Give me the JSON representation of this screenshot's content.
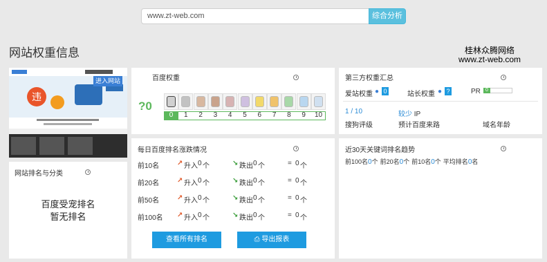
{
  "search": {
    "value": "www.zt-web.com",
    "button": "综合分析"
  },
  "page_title": "网站权重信息",
  "brand": {
    "line1": "桂林众腾网络",
    "line2": "www.zt-web.com"
  },
  "screenshot": {
    "enter_button": "进入网站"
  },
  "rank_panel": {
    "title": "网站排名与分类",
    "line1": "百度受宠排名",
    "line2": "暂无排名"
  },
  "baidu": {
    "title": "百度权重",
    "value": "?0",
    "scale": [
      "0",
      "1",
      "2",
      "3",
      "4",
      "5",
      "6",
      "7",
      "8",
      "9",
      "10"
    ],
    "colors": {
      "gray": "#8a8a8a",
      "accent": "#5cb85c"
    }
  },
  "third": {
    "title": "第三方权重汇总",
    "aizhan_label": "爱站权重",
    "aizhan_value": "0",
    "zhanzhang_label": "站长权重",
    "zhanzhang_value": "?",
    "pr_label": "PR",
    "pr_value": "0",
    "sogou_value": "1 / 10",
    "sogou_label": "搜狗评级",
    "traffic_value": "较少",
    "traffic_unit": "IP",
    "traffic_label": "预计百度来路",
    "age_label": "域名年龄"
  },
  "trend": {
    "title": "每日百度排名涨跌情况",
    "rows": [
      {
        "label": "前10名",
        "in_label": "升入",
        "in_val": "0",
        "in_unit": "个",
        "out_label": "跌出",
        "out_val": "0",
        "out_unit": "个",
        "eq": "=",
        "net": "0",
        "net_unit": "个"
      },
      {
        "label": "前20名",
        "in_label": "升入",
        "in_val": "0",
        "in_unit": "个",
        "out_label": "跌出",
        "out_val": "0",
        "out_unit": "个",
        "eq": "=",
        "net": "0",
        "net_unit": "个"
      },
      {
        "label": "前50名",
        "in_label": "升入",
        "in_val": "0",
        "in_unit": "个",
        "out_label": "跌出",
        "out_val": "0",
        "out_unit": "个",
        "eq": "=",
        "net": "0",
        "net_unit": "个"
      },
      {
        "label": "前100名",
        "in_label": "升入",
        "in_val": "0",
        "in_unit": "个",
        "out_label": "跌出",
        "out_val": "0",
        "out_unit": "个",
        "eq": "=",
        "net": "0",
        "net_unit": "个"
      }
    ],
    "btn_all": "查看所有排名",
    "btn_export": "导出报表"
  },
  "kw": {
    "title": "近30天关键词排名趋势",
    "items": [
      {
        "label": "前100名",
        "val": "0",
        "unit": "个"
      },
      {
        "label": "前20名",
        "val": "0",
        "unit": "个"
      },
      {
        "label": "前10名",
        "val": "0",
        "unit": "个"
      },
      {
        "label": "平均排名",
        "val": "0",
        "unit": "名"
      }
    ]
  }
}
